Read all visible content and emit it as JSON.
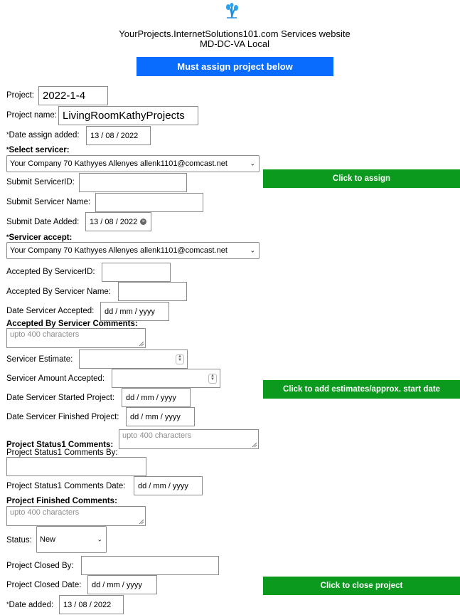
{
  "header": {
    "title_line1": "YourProjects.InternetSolutions101.com Services website",
    "title_line2": "MD-DC-VA Local",
    "banner_label": "Must assign project below"
  },
  "form": {
    "project_label": "Project:",
    "project_value": "2022-1-4",
    "project_name_label": "Project name:",
    "project_name_value": "LivingRoomKathyProjects",
    "date_assign_added_label": "Date assign added:",
    "date_assign_added_value": "13 / 08 / 2022",
    "select_servicer_label": "Select servicer:",
    "select_servicer_value": "Your Company 70 Kathyyes Allenyes allenk1101@comcast.net",
    "submit_servicer_id_label": "Submit ServicerID:",
    "submit_servicer_name_label": "Submit Servicer Name:",
    "submit_date_added_label": "Submit Date Added:",
    "submit_date_added_value": "13 / 08 / 2022",
    "servicer_accept_label": "Servicer accept:",
    "servicer_accept_value": "Your Company 70 Kathyyes Allenyes allenk1101@comcast.net",
    "accepted_by_id_label": "Accepted By ServicerID:",
    "accepted_by_name_label": "Accepted By Servicer Name:",
    "date_servicer_accepted_label": "Date Servicer Accepted:",
    "date_placeholder": "dd / mm / yyyy",
    "accepted_comments_label": "Accepted By Servicer Comments:",
    "comments_placeholder": "upto 400 characters",
    "servicer_estimate_label": "Servicer Estimate:",
    "servicer_amount_label": "Servicer Amount Accepted:",
    "date_started_label": "Date Servicer Started Project:",
    "date_finished_label": "Date Servicer Finished Project:",
    "status1_comments_label": "Project Status1 Comments:",
    "status1_comments_by_label": "Project Status1 Comments By:",
    "status1_comments_date_label": "Project Status1 Comments Date:",
    "finished_comments_label": "Project Finished Comments:",
    "status_label": "Status:",
    "status_value": "New",
    "closed_by_label": "Project Closed By:",
    "closed_date_label": "Project Closed Date:",
    "date_added_label": "Date added:",
    "date_added_value": "13 / 08 / 2022",
    "required_mark": "*"
  },
  "buttons": {
    "assign": "Click to assign",
    "estimates": "Click to add estimates/approx. start date",
    "close": "Click to close project"
  },
  "colors": {
    "green": "#0b9a1e",
    "blue": "#0a6bff"
  },
  "icons": {
    "logo": "sprout-logo-icon",
    "chevron": "chevron-down-icon",
    "clear": "clear-icon",
    "spinner": "spinner-icon",
    "resize": "resize-grip-icon"
  }
}
